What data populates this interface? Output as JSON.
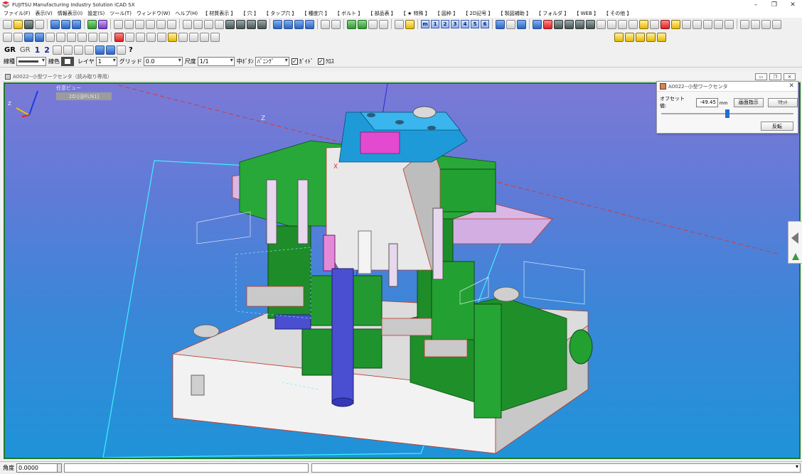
{
  "app": {
    "title": "FUJITSU Manufacturing Industry Solution iCAD SX",
    "controls": {
      "minimize": "–",
      "restore": "❐",
      "close": "✕"
    }
  },
  "menu": [
    "ファイル(F)",
    "表示(V)",
    "情報表示(I)",
    "設定(S)",
    "ツール(T)",
    "ウィンドウ(W)",
    "ヘルプ(H)",
    "【 材質表示 】",
    "【 穴 】",
    "【 タップ穴 】",
    "【 種度穴 】",
    "【 ボルト 】",
    "【 部品表 】",
    "【 ★ 特殊 】",
    "【 図枠 】",
    "【 2D記号 】",
    "【 製図補助 】",
    "【 フォルダ 】",
    "【 WEB 】",
    "【 その他 】"
  ],
  "toolbar3": {
    "gr_bold": "GR",
    "gr": "GR",
    "one": "1",
    "two": "2",
    "help": "?"
  },
  "numbered_buttons": [
    "m",
    "1",
    "2",
    "3",
    "4",
    "5",
    "6"
  ],
  "propbar": {
    "linetype_label": "線種",
    "color_label": "線色",
    "layer_label": "レイヤ",
    "layer_value": "1",
    "grid_label": "グリッド",
    "grid_value": "0.0",
    "scale_label": "尺度",
    "scale_value": "1/1",
    "middle_button_label": "中ﾎﾞﾀﾝ",
    "middle_button_value": "ﾊﾟﾆﾝｸﾞ",
    "check1_label": "ｶﾞｲﾄﾞ",
    "check2_label": "ｸﾛｽ",
    "check_mark": "✓"
  },
  "document": {
    "title": "A0022--小型ワークセンタ（読み取り専用）",
    "controls": [
      "▭",
      "❐",
      "✕"
    ]
  },
  "viewport": {
    "view_name": "任意ビュー",
    "view_chip": "2D:[@FLN1]",
    "axis_z": "Z",
    "axis_x": "X",
    "background_top": "#7b7ad6",
    "background_bottom": "#1f93d8"
  },
  "offset_dialog": {
    "title": "A0022--小型ワークセンタ",
    "close": "✕",
    "offset_label": "オフセット値:",
    "offset_value": "-49.45",
    "unit": "mm",
    "screen_button": "画面指示",
    "reset_button": "ﾘｾｯﾄ",
    "flip_button": "反転",
    "slider_value_fraction": 0.5
  },
  "statusbar": {
    "angle_label": "角度",
    "angle_value": "0.0000"
  }
}
